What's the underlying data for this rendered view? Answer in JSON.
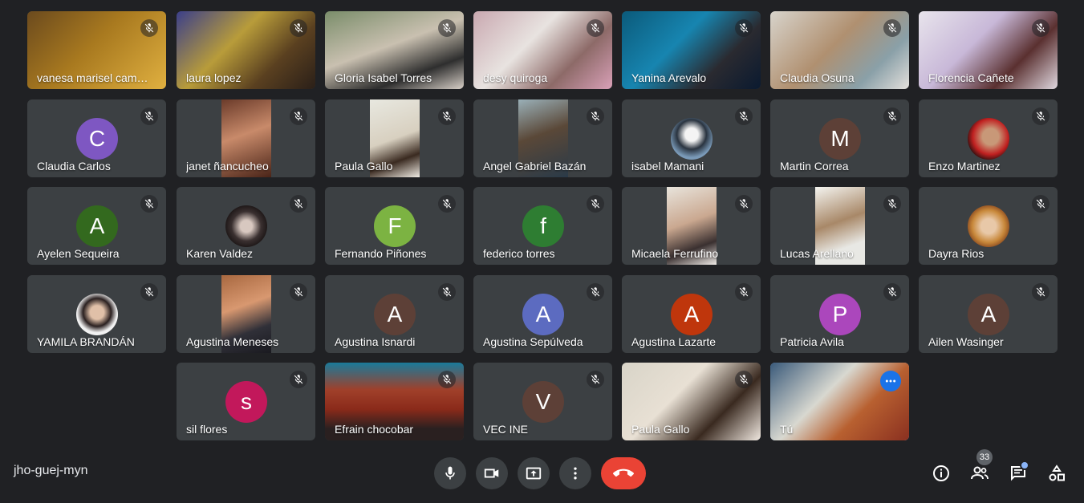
{
  "meeting": {
    "code": "jho-guej-myn"
  },
  "participant_count": "33",
  "colors": {
    "tile_bg": "#3c4043",
    "end_call": "#ea4335",
    "highlight": "#8ab4f8"
  },
  "participants": [
    {
      "name": "vanesa marisel cam…",
      "kind": "video",
      "bg": "linear-gradient(135deg,#6b4a1e,#a8791f 45%,#e0b040)"
    },
    {
      "name": "laura lopez",
      "kind": "video",
      "bg": "linear-gradient(135deg,#3b3f8a,#b89c3a 40%,#5a4020 70%,#2a1f18)"
    },
    {
      "name": "Gloria Isabel Torres",
      "kind": "video",
      "bg": "linear-gradient(160deg,#7a8d6a,#c9c0b0 45%,#2e2e2e 75%,#d8d0c8)"
    },
    {
      "name": "desy quiroga",
      "kind": "video",
      "bg": "linear-gradient(135deg,#c9a8b0,#e8e3e0 40%,#8d6a68 70%,#d9a0b8)"
    },
    {
      "name": "Yanina Arevalo",
      "kind": "video",
      "bg": "linear-gradient(135deg,#0b5a7a,#1785b0 40%,#2a2a30 70%,#0a1a30)"
    },
    {
      "name": "Claudia Osuna",
      "kind": "video",
      "bg": "linear-gradient(135deg,#d8d4cc,#b09070 45%,#8aa0a8 75%,#e4e0dc)"
    },
    {
      "name": "Florencia Cañete",
      "kind": "video",
      "bg": "linear-gradient(135deg,#e8e4ec,#c8b8d8 40%,#5a3030 70%,#e0d8e0)"
    },
    {
      "name": "Claudia Carlos",
      "kind": "avatar",
      "letter": "C",
      "color": "#7e57c2"
    },
    {
      "name": "janet ñancucheo",
      "kind": "strip",
      "bg": "linear-gradient(160deg,#6b3b2a,#c88a6a 45%,#4a2418)"
    },
    {
      "name": "Paula Gallo",
      "kind": "strip",
      "bg": "linear-gradient(160deg,#e8e8e0,#d8d0c0 50%,#3a2a20 75%,#f0ece4)"
    },
    {
      "name": "Angel Gabriel Bazán",
      "kind": "strip",
      "bg": "linear-gradient(160deg,#9ab0b8,#5a4838 45%,#2a3a48)"
    },
    {
      "name": "isabel Mamani",
      "kind": "photo",
      "bg": "radial-gradient(circle at 50% 40%,#f4f4f4 20%,#2a3440 45%,#7a9ab8 70%)"
    },
    {
      "name": "Martin Correa",
      "kind": "avatar",
      "letter": "M",
      "color": "#5d4037"
    },
    {
      "name": "Enzo Martinez",
      "kind": "photo",
      "bg": "radial-gradient(circle at 55% 45%,#c89878 25%,#c02020 55%,#301010 75%)"
    },
    {
      "name": "Ayelen Sequeira",
      "kind": "avatar",
      "letter": "A",
      "color": "#33691e"
    },
    {
      "name": "Karen Valdez",
      "kind": "photo",
      "bg": "radial-gradient(circle at 50% 50%,#d8c8c0 20%,#3a3030 50%,#1a1414 75%)"
    },
    {
      "name": "Fernando Piñones",
      "kind": "avatar",
      "letter": "F",
      "color": "#7cb342"
    },
    {
      "name": "federico torres",
      "kind": "avatar",
      "letter": "f",
      "color": "#2e7d32"
    },
    {
      "name": "Micaela Ferrufino",
      "kind": "strip",
      "bg": "linear-gradient(160deg,#e8e4dc,#caa890 45%,#3a3030 75%,#f0ece8)"
    },
    {
      "name": "Lucas Arellano",
      "kind": "strip",
      "bg": "linear-gradient(160deg,#f4f4f0,#a88868 45%,#e8e8e4 75%)"
    },
    {
      "name": "Dayra Rios",
      "kind": "photo",
      "bg": "radial-gradient(circle at 50% 50%,#e8c8a8 25%,#c8883a 55%,#8a4a20 75%)"
    },
    {
      "name": "YAMILA BRANDÁN",
      "kind": "photo",
      "bg": "radial-gradient(circle at 50% 45%,#e0c0a8 22%,#2a2020 45%,#f2f2f2 65%)"
    },
    {
      "name": "Agustina Meneses",
      "kind": "strip",
      "bg": "linear-gradient(160deg,#a86840,#d89870 40%,#303038 70%,#1a1a20)"
    },
    {
      "name": "Agustina Isnardi",
      "kind": "avatar",
      "letter": "A",
      "color": "#5d4037"
    },
    {
      "name": "Agustina Sepúlveda",
      "kind": "avatar",
      "letter": "A",
      "color": "#5c6bc0"
    },
    {
      "name": "Agustina Lazarte",
      "kind": "avatar",
      "letter": "A",
      "color": "#bf360c"
    },
    {
      "name": "Patricia Avila",
      "kind": "avatar",
      "letter": "P",
      "color": "#ab47bc"
    },
    {
      "name": "Ailen Wasinger",
      "kind": "avatar",
      "letter": "A",
      "color": "#5d4037"
    },
    {
      "name": "sil flores",
      "kind": "avatar",
      "letter": "s",
      "color": "#c2185b"
    },
    {
      "name": "Efrain chocobar",
      "kind": "video",
      "bg": "linear-gradient(180deg,#1a7a9a,#a0402a 35%,#8a2a1a 60%,#2a2020 85%)"
    },
    {
      "name": "VEC INE",
      "kind": "avatar",
      "letter": "V",
      "color": "#5d4037"
    },
    {
      "name": "Paula Gallo",
      "kind": "video",
      "bg": "linear-gradient(135deg,#d8d4c8,#e8e0d4 40%,#3a2a20 70%,#f0e8e0)"
    },
    {
      "name": "Tú",
      "kind": "video",
      "self": true,
      "bg": "linear-gradient(135deg,#3a5a7a,#d8d8d0 40%,#b86030 65%,#8a3020)"
    }
  ],
  "controls": {
    "mic": "microphone-icon",
    "camera": "camera-icon",
    "present": "present-screen-icon",
    "more": "more-options-icon",
    "hangup": "hang-up-icon",
    "info": "info-icon",
    "people": "people-icon",
    "chat": "chat-icon",
    "activities": "activities-icon"
  }
}
